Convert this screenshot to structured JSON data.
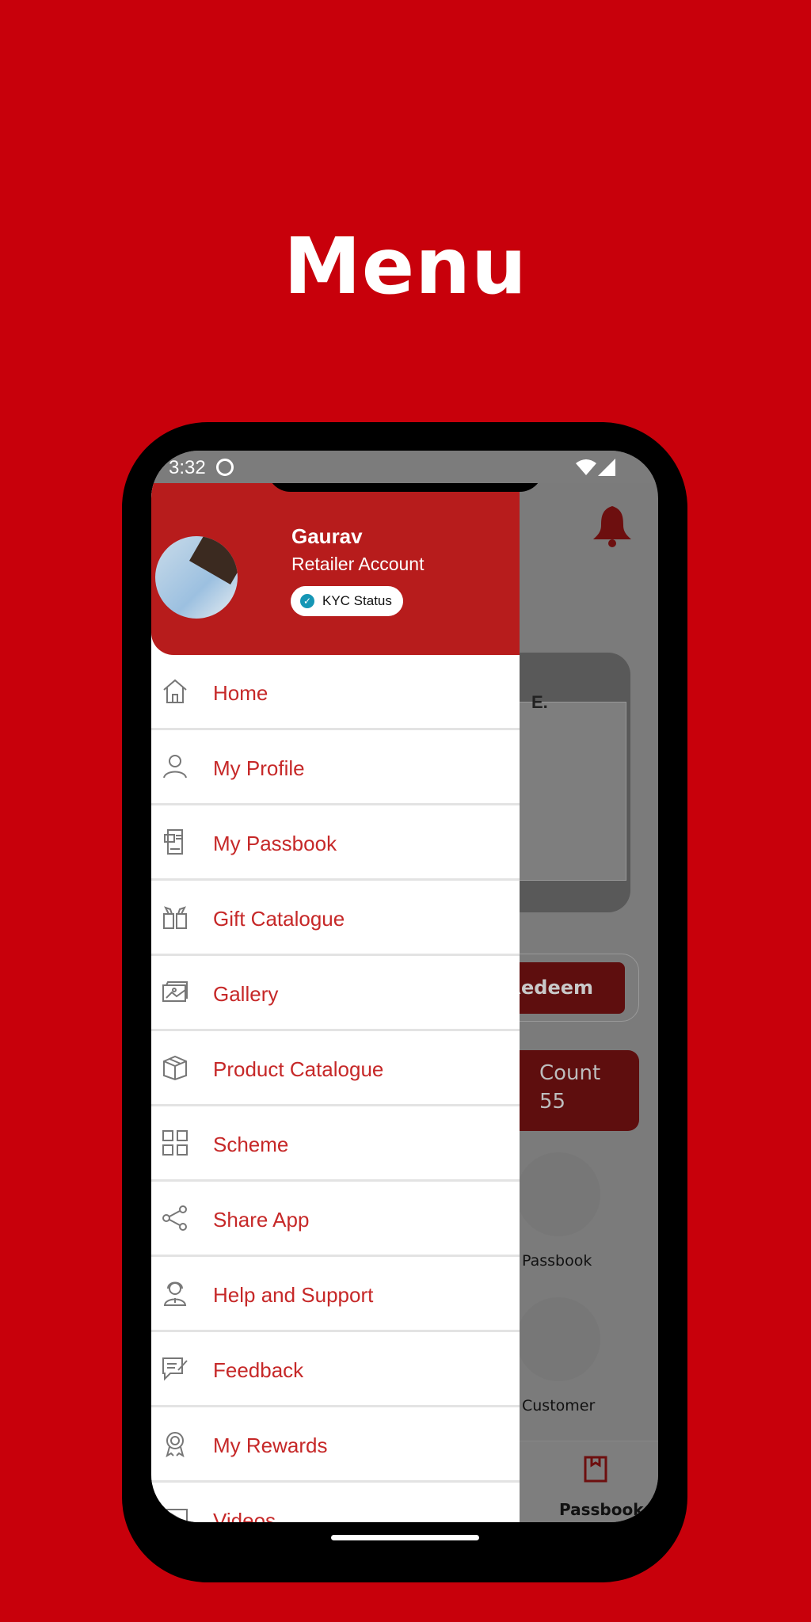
{
  "page_title": "Menu",
  "status_bar": {
    "time": "3:32"
  },
  "drawer": {
    "user_name": "Gaurav",
    "account_type": "Retailer Account",
    "kyc_label": "KYC Status",
    "items": [
      {
        "label": "Home",
        "icon": "home-icon"
      },
      {
        "label": "My Profile",
        "icon": "user-icon"
      },
      {
        "label": "My Passbook",
        "icon": "passbook-icon"
      },
      {
        "label": "Gift Catalogue",
        "icon": "gift-icon"
      },
      {
        "label": "Gallery",
        "icon": "gallery-icon"
      },
      {
        "label": "Product Catalogue",
        "icon": "box-icon"
      },
      {
        "label": "Scheme",
        "icon": "scheme-icon"
      },
      {
        "label": "Share App",
        "icon": "share-icon"
      },
      {
        "label": "Help and Support",
        "icon": "support-icon"
      },
      {
        "label": "Feedback",
        "icon": "feedback-icon"
      },
      {
        "label": "My Rewards",
        "icon": "rewards-icon"
      },
      {
        "label": "Videos",
        "icon": "video-icon"
      }
    ]
  },
  "background_screen": {
    "banner_text": "E.",
    "redeem_label": "Redeem",
    "count_label": "Count",
    "count_value": "55",
    "quick_links": [
      "Passbook",
      "Customer"
    ],
    "bottom_nav_label": "Passbook"
  },
  "colors": {
    "page_bg": "#c8000b",
    "drawer_header": "#b71c1c",
    "menu_text": "#c62828",
    "kyc_check": "#1596b5"
  }
}
